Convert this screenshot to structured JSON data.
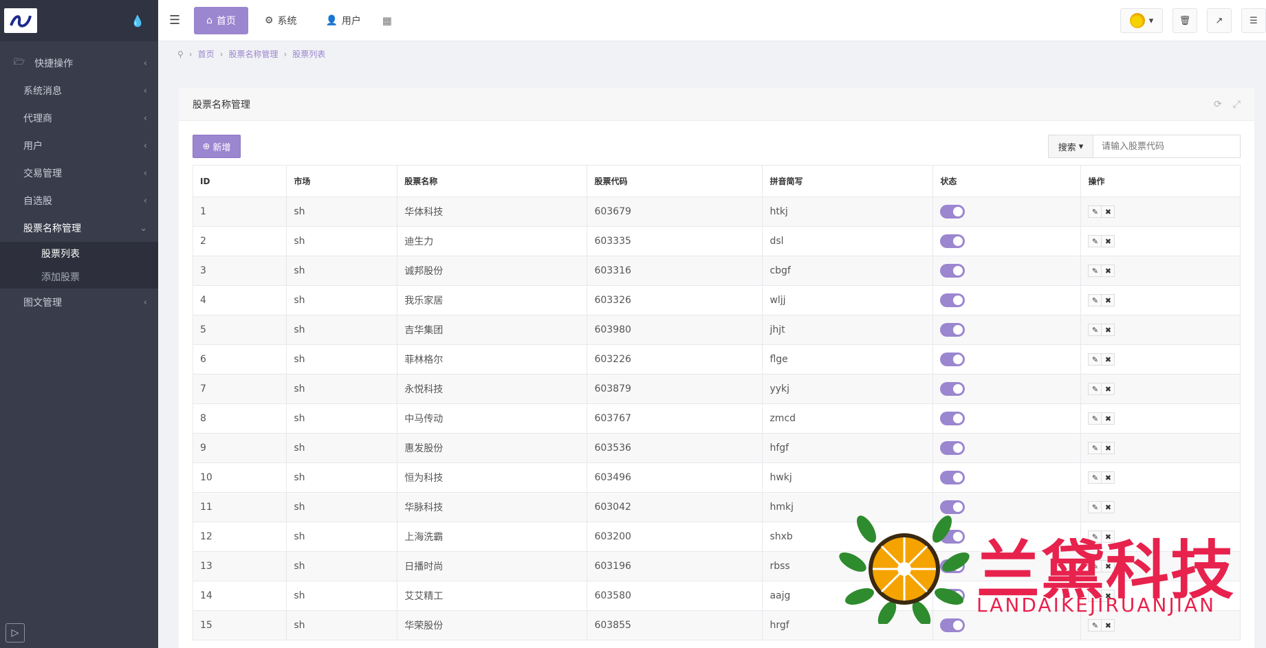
{
  "sidebar": {
    "items": [
      {
        "label": "快捷操作",
        "has_icon": true
      },
      {
        "label": "系统消息"
      },
      {
        "label": "代理商"
      },
      {
        "label": "用户"
      },
      {
        "label": "交易管理"
      },
      {
        "label": "自选股"
      },
      {
        "label": "股票名称管理",
        "expanded": true
      },
      {
        "label": "图文管理"
      }
    ],
    "sub_items": [
      {
        "label": "股票列表",
        "active": true
      },
      {
        "label": "添加股票"
      }
    ]
  },
  "topbar": {
    "tabs": [
      {
        "label": "首页",
        "icon": "home-icon",
        "active": true
      },
      {
        "label": "系统",
        "icon": "gear-icon"
      },
      {
        "label": "用户",
        "icon": "user-icon"
      }
    ]
  },
  "breadcrumb": [
    "首页",
    "股票名称管理",
    "股票列表"
  ],
  "panel": {
    "title": "股票名称管理",
    "add_label": "新增",
    "search_label": "搜索",
    "search_placeholder": "请输入股票代码"
  },
  "table": {
    "columns": [
      "ID",
      "市场",
      "股票名称",
      "股票代码",
      "拼音简写",
      "状态",
      "操作"
    ],
    "rows": [
      {
        "id": "1",
        "market": "sh",
        "name": "华体科技",
        "code": "603679",
        "pinyin": "htkj"
      },
      {
        "id": "2",
        "market": "sh",
        "name": "迪生力",
        "code": "603335",
        "pinyin": "dsl"
      },
      {
        "id": "3",
        "market": "sh",
        "name": "诚邦股份",
        "code": "603316",
        "pinyin": "cbgf"
      },
      {
        "id": "4",
        "market": "sh",
        "name": "我乐家居",
        "code": "603326",
        "pinyin": "wljj"
      },
      {
        "id": "5",
        "market": "sh",
        "name": "吉华集团",
        "code": "603980",
        "pinyin": "jhjt"
      },
      {
        "id": "6",
        "market": "sh",
        "name": "菲林格尔",
        "code": "603226",
        "pinyin": "flge"
      },
      {
        "id": "7",
        "market": "sh",
        "name": "永悦科技",
        "code": "603879",
        "pinyin": "yykj"
      },
      {
        "id": "8",
        "market": "sh",
        "name": "中马传动",
        "code": "603767",
        "pinyin": "zmcd"
      },
      {
        "id": "9",
        "market": "sh",
        "name": "惠发股份",
        "code": "603536",
        "pinyin": "hfgf"
      },
      {
        "id": "10",
        "market": "sh",
        "name": "恒为科技",
        "code": "603496",
        "pinyin": "hwkj"
      },
      {
        "id": "11",
        "market": "sh",
        "name": "华脉科技",
        "code": "603042",
        "pinyin": "hmkj"
      },
      {
        "id": "12",
        "market": "sh",
        "name": "上海洗霸",
        "code": "603200",
        "pinyin": "shxb"
      },
      {
        "id": "13",
        "market": "sh",
        "name": "日播时尚",
        "code": "603196",
        "pinyin": "rbss"
      },
      {
        "id": "14",
        "market": "sh",
        "name": "艾艾精工",
        "code": "603580",
        "pinyin": "aajg"
      },
      {
        "id": "15",
        "market": "sh",
        "name": "华荣股份",
        "code": "603855",
        "pinyin": "hrgf"
      }
    ]
  },
  "watermark": {
    "title": "兰黛科技",
    "subtitle": "LANDAIKEJIRUANJIAN"
  },
  "colors": {
    "accent": "#9b86d0",
    "sidebar_bg": "#393d4b",
    "watermark_red": "#e7224d"
  }
}
